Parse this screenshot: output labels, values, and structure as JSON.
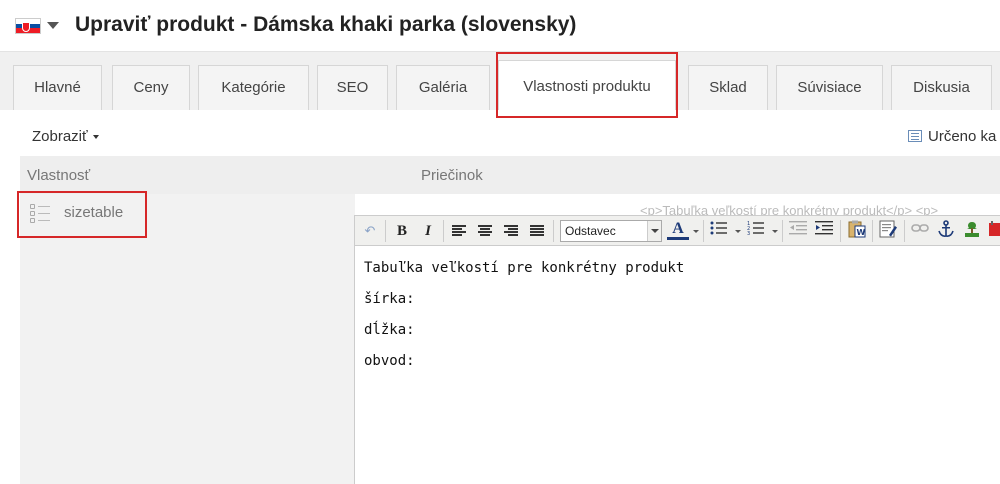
{
  "header": {
    "title": "Upraviť produkt - Dámska khaki parka (slovensky)",
    "language_flag": "flag-slovakia-icon"
  },
  "tabs": [
    {
      "label": "Hlavné"
    },
    {
      "label": "Ceny"
    },
    {
      "label": "Kategórie"
    },
    {
      "label": "SEO"
    },
    {
      "label": "Galéria"
    },
    {
      "label": "Vlastnosti produktu",
      "active": true
    },
    {
      "label": "Sklad"
    },
    {
      "label": "Súvisiace"
    },
    {
      "label": "Diskusia"
    }
  ],
  "toolbar_top": {
    "show_label": "Zobraziť",
    "filter_label": "Určeno ka"
  },
  "grid": {
    "columns": [
      "Vlastnosť",
      "Priečinok"
    ],
    "rows": [
      {
        "name": "sizetable",
        "preview": "<p>Tabuľka veľkostí pre konkrétny produkt</p> <p>"
      }
    ]
  },
  "editor": {
    "format_value": "Odstavec",
    "content_lines": [
      "Tabuľka veľkostí pre konkrétny produkt",
      "šírka:",
      "dĺžka:",
      "obvod:"
    ]
  },
  "colors": {
    "highlight": "#d62728",
    "tab_bg": "#f4f4f4",
    "tab_active_bg": "#ffffff"
  }
}
